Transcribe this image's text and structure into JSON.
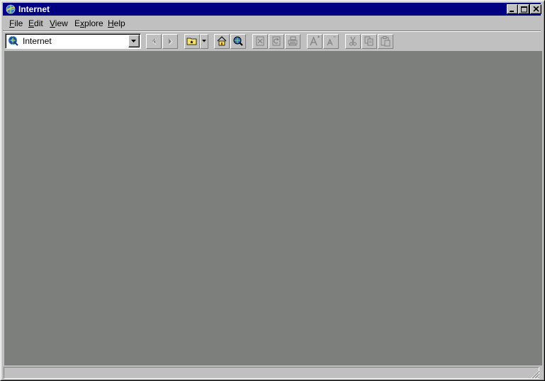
{
  "window": {
    "title": "Internet",
    "title_icon": "ie-globe-icon",
    "colors": {
      "titlebar": "#000080",
      "title_text": "#ffffff",
      "chrome": "#c0c0c0",
      "content": "#7d7f7c"
    },
    "controls": [
      "minimize-icon",
      "maximize-icon",
      "close-icon"
    ]
  },
  "menubar": {
    "items": [
      {
        "label": "File",
        "mnemonic": "F"
      },
      {
        "label": "Edit",
        "mnemonic": "E"
      },
      {
        "label": "View",
        "mnemonic": "V"
      },
      {
        "label": "Explore",
        "mnemonic": "x"
      },
      {
        "label": "Help",
        "mnemonic": "H"
      }
    ]
  },
  "toolbar": {
    "address": {
      "value": "Internet",
      "icon": "ie-globe-icon"
    },
    "buttons": [
      {
        "name": "back",
        "icon": "back-arrow-icon",
        "enabled": false
      },
      {
        "name": "forward",
        "icon": "forward-arrow-icon",
        "enabled": false
      },
      {
        "name": "open-favorites",
        "icon": "folder-star-icon",
        "enabled": true
      },
      {
        "name": "home",
        "icon": "home-icon",
        "enabled": true
      },
      {
        "name": "search",
        "icon": "search-globe-icon",
        "enabled": true
      },
      {
        "name": "stop",
        "icon": "stop-icon",
        "enabled": false
      },
      {
        "name": "refresh",
        "icon": "refresh-icon",
        "enabled": false
      },
      {
        "name": "print",
        "icon": "print-icon",
        "enabled": false
      },
      {
        "name": "font-larger",
        "icon": "font-larger-icon",
        "enabled": false
      },
      {
        "name": "font-smaller",
        "icon": "font-smaller-icon",
        "enabled": false
      },
      {
        "name": "cut",
        "icon": "cut-icon",
        "enabled": false
      },
      {
        "name": "copy",
        "icon": "copy-icon",
        "enabled": false
      },
      {
        "name": "paste",
        "icon": "paste-icon",
        "enabled": false
      }
    ]
  },
  "statusbar": {
    "text": ""
  }
}
